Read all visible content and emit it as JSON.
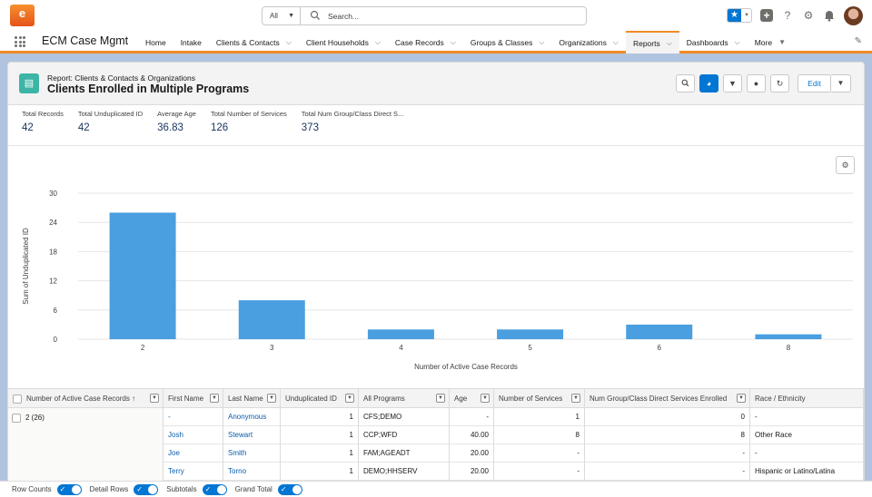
{
  "header": {
    "logo_letter": "e",
    "search_scope": "All",
    "search_placeholder": "Search...",
    "help_glyph": "?",
    "icons": [
      "star-icon",
      "plus-icon",
      "help-icon",
      "gear-icon",
      "bell-icon",
      "avatar"
    ]
  },
  "nav": {
    "app_name": "ECM Case Mgmt",
    "items": [
      {
        "label": "Home",
        "chevron": false
      },
      {
        "label": "Intake",
        "chevron": false
      },
      {
        "label": "Clients & Contacts",
        "chevron": true
      },
      {
        "label": "Client Households",
        "chevron": true
      },
      {
        "label": "Case Records",
        "chevron": true
      },
      {
        "label": "Groups & Classes",
        "chevron": true
      },
      {
        "label": "Organizations",
        "chevron": true
      },
      {
        "label": "Reports",
        "chevron": true,
        "active": true
      },
      {
        "label": "Dashboards",
        "chevron": true
      },
      {
        "label": "More",
        "chevron": false,
        "caret": true
      }
    ]
  },
  "report": {
    "type": "Report: Clients & Contacts & Organizations",
    "title": "Clients Enrolled in Multiple Programs",
    "edit_label": "Edit"
  },
  "summary": [
    {
      "label": "Total Records",
      "value": "42"
    },
    {
      "label": "Total Unduplicated ID",
      "value": "42"
    },
    {
      "label": "Average Age",
      "value": "36.83"
    },
    {
      "label": "Total Number of Services",
      "value": "126"
    },
    {
      "label": "Total Num Group/Class Direct S...",
      "value": "373"
    }
  ],
  "chart_data": {
    "type": "bar",
    "categories": [
      "2",
      "3",
      "4",
      "5",
      "6",
      "8"
    ],
    "values": [
      26,
      8,
      2,
      2,
      3,
      1
    ],
    "xlabel": "Number of Active Case Records",
    "ylabel": "Sum of Unduplicated ID",
    "yticks": [
      0,
      6,
      12,
      18,
      24,
      30
    ],
    "ylim": [
      0,
      30
    ],
    "grid": true,
    "bar_color": "#4a9fe0"
  },
  "table": {
    "columns": [
      {
        "label": "Number of Active Case Records",
        "sort": "↑"
      },
      {
        "label": "First Name"
      },
      {
        "label": "Last Name"
      },
      {
        "label": "Unduplicated ID"
      },
      {
        "label": "All Programs"
      },
      {
        "label": "Age"
      },
      {
        "label": "Number of Services"
      },
      {
        "label": "Num Group/Class Direct Services Enrolled"
      },
      {
        "label": "Race / Ethnicity"
      }
    ],
    "group_label": "2 (26)",
    "rows": [
      {
        "first": "-",
        "last": "Anonymous",
        "uid": "1",
        "programs": "CFS;DEMO",
        "age": "-",
        "services": "1",
        "group": "0",
        "race": "-"
      },
      {
        "first": "Josh",
        "last": "Stewart",
        "uid": "1",
        "programs": "CCP;WFD",
        "age": "40.00",
        "services": "8",
        "group": "8",
        "race": "Other Race"
      },
      {
        "first": "Joe",
        "last": "Smith",
        "uid": "1",
        "programs": "FAM;AGEADT",
        "age": "20.00",
        "services": "-",
        "group": "-",
        "race": "-"
      },
      {
        "first": "Terry",
        "last": "Torno",
        "uid": "1",
        "programs": "DEMO;HHSERV",
        "age": "20.00",
        "services": "-",
        "group": "-",
        "race": "Hispanic or Latino/Latina"
      }
    ]
  },
  "footer": {
    "toggles": [
      {
        "label": "Row Counts",
        "on": true
      },
      {
        "label": "Detail Rows",
        "on": true
      },
      {
        "label": "Subtotals",
        "on": true
      },
      {
        "label": "Grand Total",
        "on": true
      }
    ]
  },
  "colors": {
    "accent": "#0176d3",
    "nav_highlight": "#f08a24",
    "report_icon": "#3cb5a6"
  }
}
